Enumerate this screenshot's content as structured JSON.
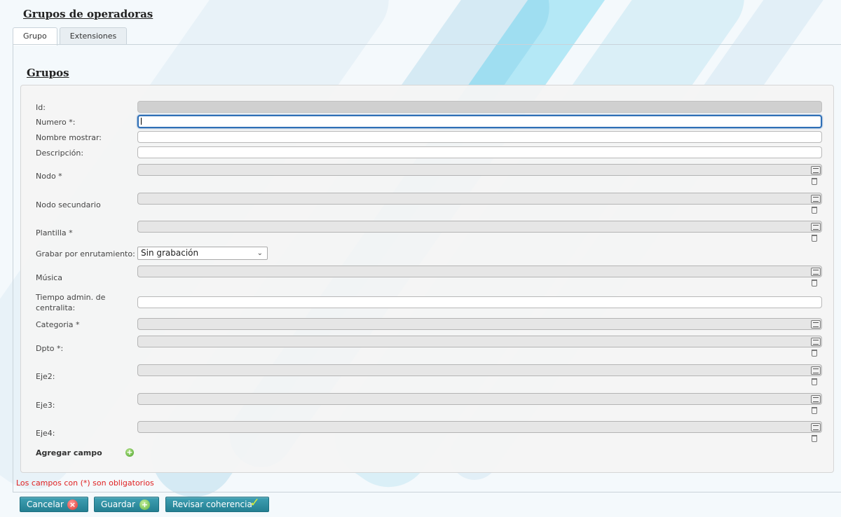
{
  "page_title": "Grupos de operadoras",
  "tabs": [
    {
      "label": "Grupo",
      "active": true
    },
    {
      "label": "Extensiones",
      "active": false
    }
  ],
  "section_title": "Grupos",
  "fields": {
    "id": {
      "label": "Id:",
      "value": ""
    },
    "numero": {
      "label": "Numero *:",
      "value": ""
    },
    "nombre_mostrar": {
      "label": "Nombre mostrar:",
      "value": ""
    },
    "descripcion": {
      "label": "Descripción:",
      "value": ""
    },
    "nodo": {
      "label": "Nodo *",
      "value": ""
    },
    "nodo_secundario": {
      "label": "Nodo secundario",
      "value": ""
    },
    "plantilla": {
      "label": "Plantilla *",
      "value": ""
    },
    "grabar": {
      "label": "Grabar por enrutamiento:",
      "value": "Sin grabación"
    },
    "musica": {
      "label": "Música",
      "value": ""
    },
    "tiempo_admin": {
      "label": "Tiempo admin. de centralita:",
      "value": ""
    },
    "categoria": {
      "label": "Categoria *",
      "value": ""
    },
    "dpto": {
      "label": "Dpto *:",
      "value": ""
    },
    "eje2": {
      "label": "Eje2:",
      "value": ""
    },
    "eje3": {
      "label": "Eje3:",
      "value": ""
    },
    "eje4": {
      "label": "Eje4:",
      "value": ""
    }
  },
  "add_field_label": "Agregar campo",
  "required_note": "Los campos con (*) son obligatorios",
  "buttons": {
    "cancel": "Cancelar",
    "save": "Guardar",
    "check": "Revisar coherencia"
  },
  "colors": {
    "button_bg": "#2b8ea1",
    "focus_border": "#2f6fb6",
    "required_note": "#e02020"
  },
  "icons": [
    "list-icon",
    "trash-icon",
    "add-icon",
    "cancel-icon",
    "save-icon",
    "check-icon"
  ]
}
